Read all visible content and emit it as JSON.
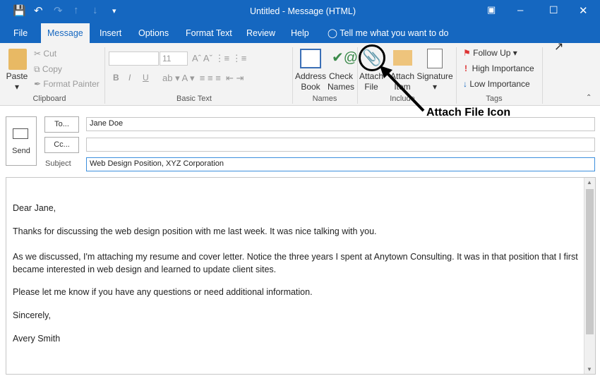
{
  "window": {
    "title": "Untitled  -  Message (HTML)",
    "accent": "#1567c0"
  },
  "tabs": [
    {
      "label": "File"
    },
    {
      "label": "Message"
    },
    {
      "label": "Insert"
    },
    {
      "label": "Options"
    },
    {
      "label": "Format Text"
    },
    {
      "label": "Review"
    },
    {
      "label": "Help"
    }
  ],
  "tell_me": "Tell me what you want to do",
  "ribbon": {
    "clipboard": {
      "paste": "Paste",
      "cut": "Cut",
      "copy": "Copy",
      "format_painter": "Format Painter",
      "label": "Clipboard"
    },
    "basic_text": {
      "font_size": "11",
      "label": "Basic Text",
      "bold": "B",
      "italic": "I",
      "underline": "U"
    },
    "names": {
      "address_book": "Address Book",
      "check_names": "Check Names",
      "label": "Names"
    },
    "include": {
      "attach_file": "Attach File",
      "attach_item": "Attach Item",
      "signature": "Signature",
      "label": "Include"
    },
    "tags": {
      "follow_up": "Follow Up",
      "high": "High Importance",
      "low": "Low Importance",
      "label": "Tags"
    }
  },
  "annotation": "Attach File Icon",
  "compose": {
    "send": "Send",
    "to_btn": "To...",
    "cc_btn": "Cc...",
    "subject_label": "Subject",
    "to": "Jane Doe",
    "cc": "",
    "subject": "Web Design Position, XYZ Corporation"
  },
  "body": [
    "Dear Jane,",
    "Thanks for discussing the web design position with me last week. It was nice talking with you.",
    "As we discussed, I'm attaching my resume and cover letter. Notice the three years I spent at Anytown Consulting. It was in that position that I first became interested in web design and learned to update client sites.",
    "Please let me know if you have any questions or need additional information.",
    "Sincerely,",
    "Avery Smith"
  ]
}
